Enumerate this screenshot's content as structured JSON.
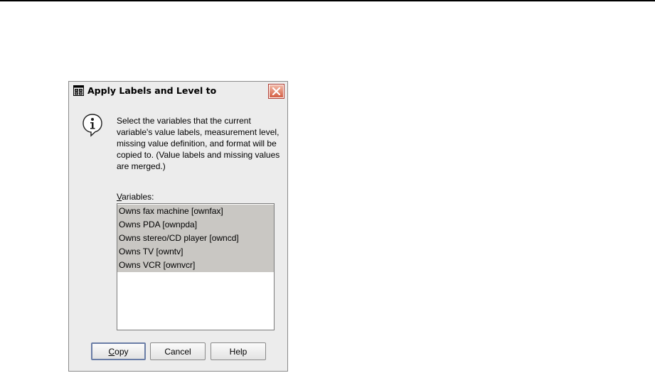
{
  "dialog": {
    "title": "Apply Labels and Level to",
    "message": "Select the variables that the current variable's value labels, measurement level, missing value definition, and format will be copied to. (Value labels and missing values are merged.)",
    "variables_label_mnemonic": "V",
    "variables_label_rest": "ariables:",
    "variables": [
      "Owns fax machine [ownfax]",
      "Owns PDA [ownpda]",
      "Owns stereo/CD player [owncd]",
      "Owns TV [owntv]",
      "Owns VCR [ownvcr]"
    ],
    "buttons": {
      "copy_mnemonic": "C",
      "copy_rest": "opy",
      "cancel": "Cancel",
      "help": "Help"
    }
  },
  "icons": {
    "app": "spss-dialog-icon",
    "info": "info-icon",
    "close": "close-icon"
  },
  "colors": {
    "dialog_bg": "#ececec",
    "selection": "#c9c7c3",
    "close_button": "#d35f45",
    "default_button_border": "#6a7da6"
  }
}
